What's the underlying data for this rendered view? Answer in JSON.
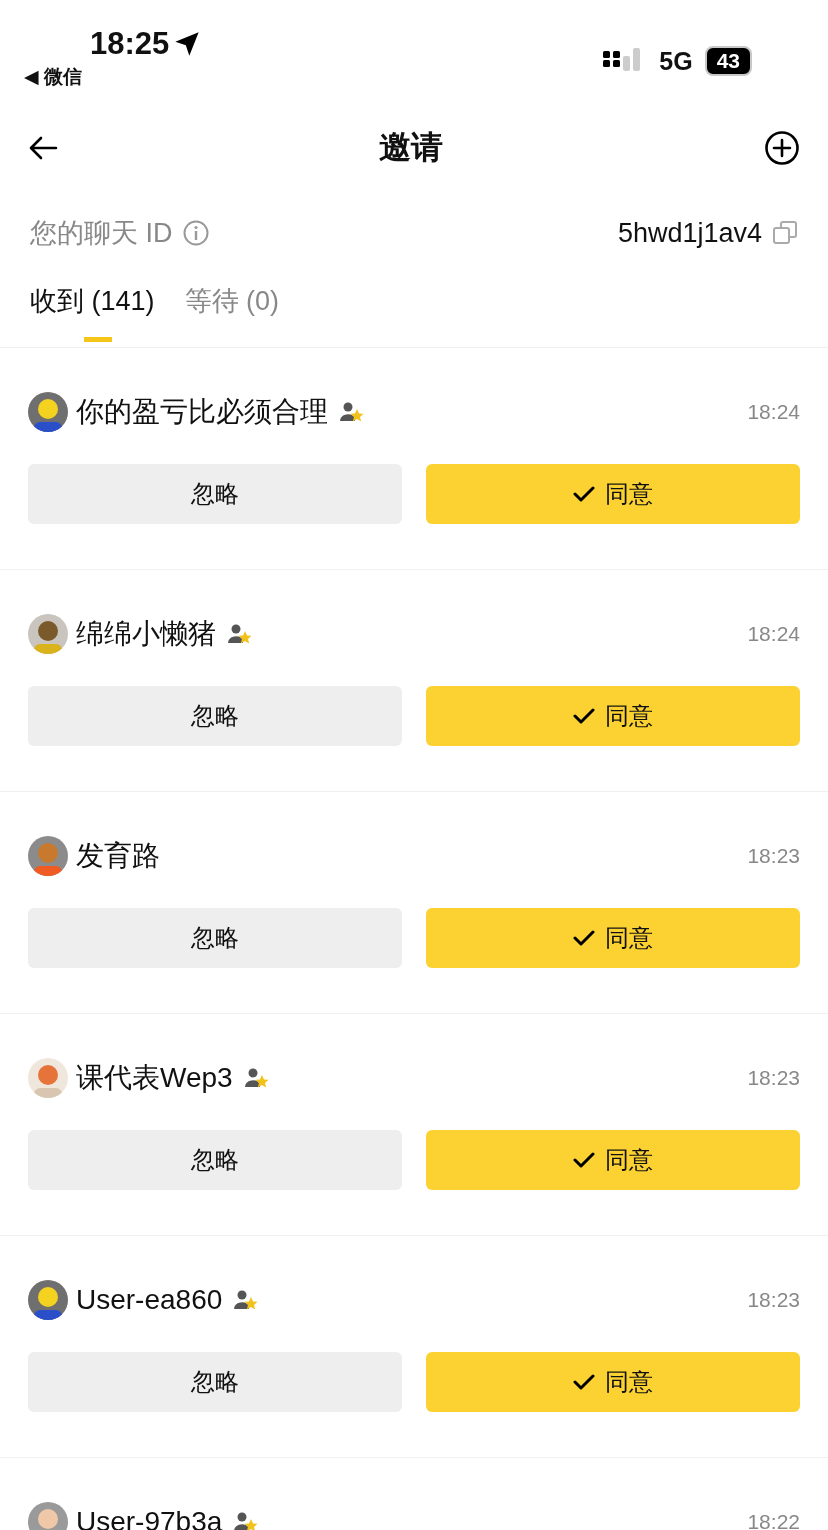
{
  "status_bar": {
    "time": "18:25",
    "back_app": "◀ 微信",
    "network": "5G",
    "battery": "43"
  },
  "nav": {
    "title": "邀请"
  },
  "chat_id": {
    "label": "您的聊天 ID",
    "value": "5hwd1j1av4"
  },
  "tabs": [
    {
      "label": "收到 (141)",
      "selected": true
    },
    {
      "label": "等待 (0)",
      "selected": false
    }
  ],
  "invites": [
    {
      "name": "你的盈亏比必须合理",
      "badge": true,
      "time": "18:24",
      "ignore": "忽略",
      "accept": "同意"
    },
    {
      "name": "绵绵小懒猪",
      "badge": true,
      "time": "18:24",
      "ignore": "忽略",
      "accept": "同意"
    },
    {
      "name": "发育路",
      "badge": false,
      "time": "18:23",
      "ignore": "忽略",
      "accept": "同意"
    },
    {
      "name": "课代表Wep3",
      "badge": true,
      "time": "18:23",
      "ignore": "忽略",
      "accept": "同意"
    },
    {
      "name": "User-ea860",
      "badge": true,
      "time": "18:23",
      "ignore": "忽略",
      "accept": "同意"
    },
    {
      "name": "User-97b3a",
      "badge": true,
      "time": "18:22"
    }
  ]
}
